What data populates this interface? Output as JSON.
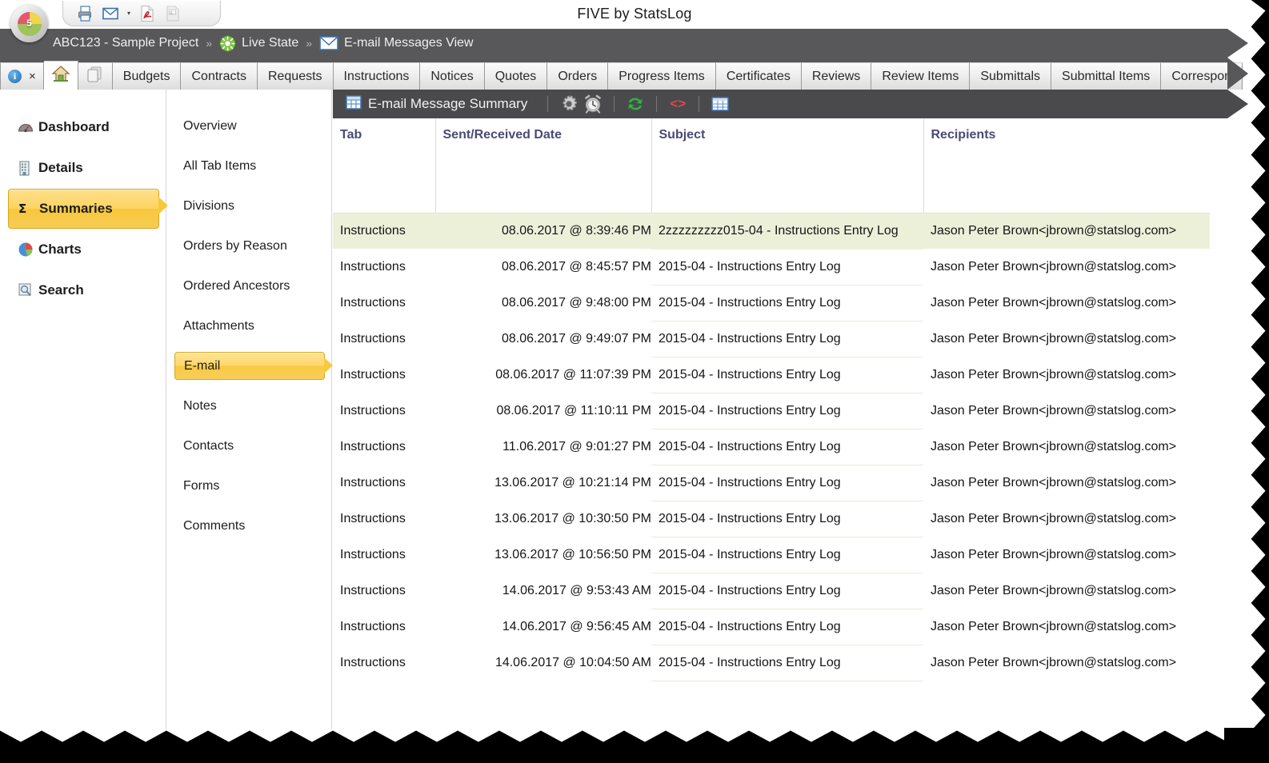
{
  "app": {
    "title": "FIVE by StatsLog",
    "logo_label": "5"
  },
  "quick_access": [
    {
      "name": "print-icon",
      "label": "Print"
    },
    {
      "name": "email-icon",
      "label": "E-mail"
    },
    {
      "name": "email-dropdown-caret",
      "label": "▾"
    },
    {
      "name": "pdf-icon",
      "label": "Export PDF"
    },
    {
      "name": "document-icon",
      "label": "Document"
    }
  ],
  "breadcrumb": {
    "project": "ABC123 - Sample Project",
    "separator": "»",
    "state": "Live State",
    "view": "E-mail Messages View"
  },
  "tabs": {
    "info_label": "i",
    "close_label": "×",
    "items": [
      "Budgets",
      "Contracts",
      "Requests",
      "Instructions",
      "Notices",
      "Quotes",
      "Orders",
      "Progress Items",
      "Certificates",
      "Reviews",
      "Review Items",
      "Submittals",
      "Submittal Items",
      "Correspon"
    ]
  },
  "sidebar": {
    "items": [
      {
        "label": "Dashboard",
        "icon": "gauge-icon",
        "selected": false
      },
      {
        "label": "Details",
        "icon": "building-icon",
        "selected": false
      },
      {
        "label": "Summaries",
        "icon": "sigma-icon",
        "selected": true
      },
      {
        "label": "Charts",
        "icon": "pie-chart-icon",
        "selected": false
      },
      {
        "label": "Search",
        "icon": "magnifier-icon",
        "selected": false
      }
    ]
  },
  "subnav": {
    "items": [
      {
        "label": "Overview",
        "selected": false
      },
      {
        "label": "All Tab Items",
        "selected": false
      },
      {
        "label": "Divisions",
        "selected": false
      },
      {
        "label": "Orders by Reason",
        "selected": false
      },
      {
        "label": "Ordered Ancestors",
        "selected": false
      },
      {
        "label": "Attachments",
        "selected": false
      },
      {
        "label": "E-mail",
        "selected": true
      },
      {
        "label": "Notes",
        "selected": false
      },
      {
        "label": "Contacts",
        "selected": false
      },
      {
        "label": "Forms",
        "selected": false
      },
      {
        "label": "Comments",
        "selected": false
      }
    ]
  },
  "content_toolbar": {
    "title": "E-mail Message Summary",
    "buttons": [
      {
        "name": "grid-icon",
        "label": "Grid"
      },
      {
        "name": "gear-icon",
        "label": "Settings"
      },
      {
        "name": "alarm-clock-icon",
        "label": "Schedule"
      },
      {
        "name": "refresh-icon",
        "label": "Refresh"
      },
      {
        "name": "code-icon",
        "label": "<>"
      },
      {
        "name": "table-view-icon",
        "label": "Table View"
      }
    ]
  },
  "table": {
    "columns": [
      "Tab",
      "Sent/Received Date",
      "Subject",
      "Recipients"
    ],
    "rows": [
      {
        "tab": "Instructions",
        "date": "08.06.2017 @ 8:39:46 PM",
        "subject": "2zzzzzzzzz015-04 - Instructions Entry Log",
        "recipients": "Jason Peter Brown<jbrown@statslog.com>",
        "highlighted": true
      },
      {
        "tab": "Instructions",
        "date": "08.06.2017 @ 8:45:57 PM",
        "subject": "2015-04 - Instructions Entry Log",
        "recipients": "Jason Peter Brown<jbrown@statslog.com>",
        "highlighted": false
      },
      {
        "tab": "Instructions",
        "date": "08.06.2017 @ 9:48:00 PM",
        "subject": "2015-04 - Instructions Entry Log",
        "recipients": "Jason Peter Brown<jbrown@statslog.com>",
        "highlighted": false
      },
      {
        "tab": "Instructions",
        "date": "08.06.2017 @ 9:49:07 PM",
        "subject": "2015-04 - Instructions Entry Log",
        "recipients": "Jason Peter Brown<jbrown@statslog.com>",
        "highlighted": false
      },
      {
        "tab": "Instructions",
        "date": "08.06.2017 @ 11:07:39 PM",
        "subject": "2015-04 - Instructions Entry Log",
        "recipients": "Jason Peter Brown<jbrown@statslog.com>",
        "highlighted": false
      },
      {
        "tab": "Instructions",
        "date": "08.06.2017 @ 11:10:11 PM",
        "subject": "2015-04 - Instructions Entry Log",
        "recipients": "Jason Peter Brown<jbrown@statslog.com>",
        "highlighted": false
      },
      {
        "tab": "Instructions",
        "date": "11.06.2017 @ 9:01:27 PM",
        "subject": "2015-04 - Instructions Entry Log",
        "recipients": "Jason Peter Brown<jbrown@statslog.com>",
        "highlighted": false
      },
      {
        "tab": "Instructions",
        "date": "13.06.2017 @ 10:21:14 PM",
        "subject": "2015-04 - Instructions Entry Log",
        "recipients": "Jason Peter Brown<jbrown@statslog.com>",
        "highlighted": false
      },
      {
        "tab": "Instructions",
        "date": "13.06.2017 @ 10:30:50 PM",
        "subject": "2015-04 - Instructions Entry Log",
        "recipients": "Jason Peter Brown<jbrown@statslog.com>",
        "highlighted": false
      },
      {
        "tab": "Instructions",
        "date": "13.06.2017 @ 10:56:50 PM",
        "subject": "2015-04 - Instructions Entry Log",
        "recipients": "Jason Peter Brown<jbrown@statslog.com>",
        "highlighted": false
      },
      {
        "tab": "Instructions",
        "date": "14.06.2017 @ 9:53:43 AM",
        "subject": "2015-04 - Instructions Entry Log",
        "recipients": "Jason Peter Brown<jbrown@statslog.com>",
        "highlighted": false
      },
      {
        "tab": "Instructions",
        "date": "14.06.2017 @ 9:56:45 AM",
        "subject": "2015-04 - Instructions Entry Log",
        "recipients": "Jason Peter Brown<jbrown@statslog.com>",
        "highlighted": false
      },
      {
        "tab": "Instructions",
        "date": "14.06.2017 @ 10:04:50 AM",
        "subject": "2015-04 - Instructions Entry Log",
        "recipients": "Jason Peter Brown<jbrown@statslog.com>",
        "highlighted": false
      }
    ]
  },
  "colors": {
    "chrome_dark": "#58585a",
    "toolbar_dark": "#4a4a4c",
    "accent_gold": "#f8c73c",
    "header_text": "#4a4a75",
    "row_highlight": "#edf0d9"
  }
}
